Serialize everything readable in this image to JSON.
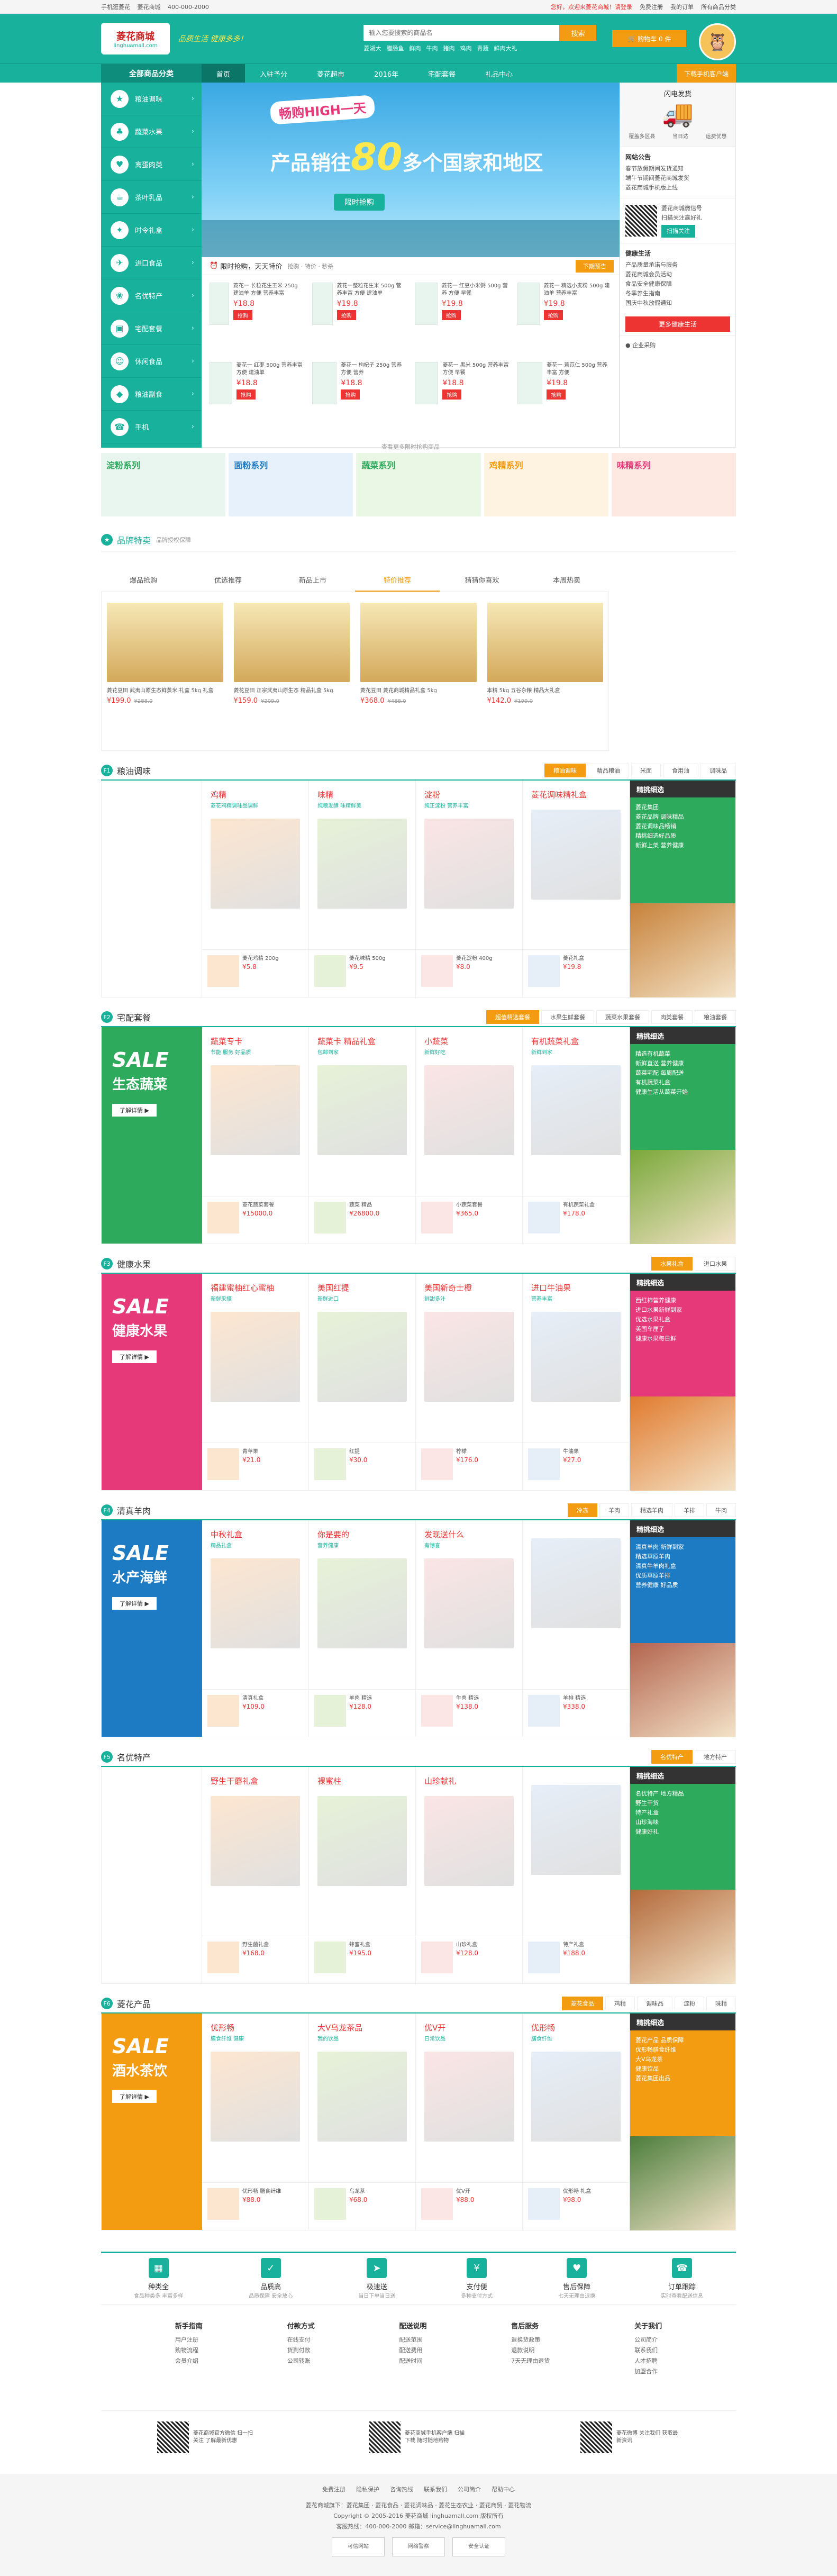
{
  "topbar": {
    "left": [
      "手机逛菱花",
      "菱花商城",
      "400-000-2000"
    ],
    "right": [
      "您好，欢迎来菱花商城！请登录",
      "免费注册",
      "我的订单",
      "所有商品分类"
    ]
  },
  "header": {
    "logo": "菱花商城",
    "logo_sub": "linghuamall.com",
    "slogan": "品质生活 健康多多！",
    "search_placeholder": "输入您要搜索的商品名",
    "search_button": "搜索",
    "hot": [
      "菱湖大",
      "腊肠鱼",
      "鲜肉",
      "牛肉",
      "猪肉",
      "鸡肉",
      "青蔬",
      "鲜肉大礼"
    ],
    "cart": "购物车 0 件"
  },
  "nav": {
    "allcat": "全部商品分类",
    "items": [
      "首页",
      "入驻予分",
      "菱花超市",
      "2016年",
      "宅配套餐",
      "礼品中心"
    ],
    "download": "下载手机客户端"
  },
  "cats": [
    {
      "label": "粮油调味",
      "icon": "★"
    },
    {
      "label": "蔬菜水果",
      "icon": "♣"
    },
    {
      "label": "禽蛋肉类",
      "icon": "♥"
    },
    {
      "label": "茶叶乳品",
      "icon": "☕"
    },
    {
      "label": "时令礼盒",
      "icon": "✦"
    },
    {
      "label": "进口食品",
      "icon": "✈"
    },
    {
      "label": "名优特产",
      "icon": "❀"
    },
    {
      "label": "宅配套餐",
      "icon": "▣"
    },
    {
      "label": "休闲食品",
      "icon": "☺"
    },
    {
      "label": "粮油副食",
      "icon": "◆"
    },
    {
      "label": "手机",
      "icon": "☎"
    }
  ],
  "banner": {
    "tag": "畅购HIGH一天",
    "line1": "产品销往",
    "num": "80",
    "line2": "多个国家和地区",
    "go": "限时抢购"
  },
  "flash": {
    "title": "限时抢购，天天特价",
    "sub": "抢购 · 特价 · 秒杀",
    "more": "下期预告",
    "buy": "抢购",
    "items": [
      {
        "t": "菱花一 长粒花生王米 250g 建油单 方便 营养丰富",
        "p": "¥18.8"
      },
      {
        "t": "菱花一整粒花生米 500g 营养丰富 方便 建油单",
        "p": "¥19.8"
      },
      {
        "t": "菱花一 红豆小米粥 500g 营养 方便 早餐",
        "p": "¥19.8"
      },
      {
        "t": "菱花一 精选小麦粉 500g 建油单 营养丰富",
        "p": "¥19.8"
      },
      {
        "t": "菱花一 红枣 500g 营养丰富 方便 建油单",
        "p": "¥18.8"
      },
      {
        "t": "菱花一 枸杞子 250g 营养 方便 营养",
        "p": "¥18.8"
      },
      {
        "t": "菱花一 黑米 500g 营养丰富 方便 早餐",
        "p": "¥18.8"
      },
      {
        "t": "菱花一 薏苡仁 500g 营养丰富 方便",
        "p": "¥19.8"
      }
    ],
    "more2": "查看更多限时抢购商品"
  },
  "side": {
    "delivery": "闪电发货",
    "d_items": [
      "覆盖多区县",
      "当日达",
      "运费优惠"
    ],
    "notice": "网站公告",
    "notices": [
      "春节放假期间发货通知",
      "端午节期间菱花商城发货",
      "菱花商城手机版上线"
    ],
    "qr_title": "菱花商城微信号",
    "qr_sub": "扫描关注赢好礼",
    "qr_btn": "扫描关注",
    "news": "健康生活",
    "news_items": [
      "产品质量承诺与服务",
      "菱花商城会员活动",
      "食品安全健康保障",
      "冬季养生指南",
      "国庆中秋放假通知"
    ],
    "redbtn": "更多健康生活",
    "corp": "企业采购"
  },
  "promo": [
    "淀粉系列",
    "面粉系列",
    "蔬菜系列",
    "鸡精系列",
    "味精系列"
  ],
  "brand": {
    "title": "品牌特卖",
    "sub": "品牌授权保障",
    "tabs": [
      "爆品抢购",
      "优选推荐",
      "新品上市",
      "特价推荐",
      "猜猜你喜欢",
      "本周热卖"
    ],
    "items": [
      {
        "t": "菱花豆田 武夷山原生态鲜蒸米 礼盒 5kg 礼盒",
        "p": "¥199.0",
        "o": "¥288.0"
      },
      {
        "t": "菱花豆田 正宗武夷山原生态 精品礼盒 5kg",
        "p": "¥159.0",
        "o": "¥209.0"
      },
      {
        "t": "菱花豆田 菱花商城精品礼盒 5kg",
        "p": "¥368.0",
        "o": "¥488.0"
      },
      {
        "t": "本精 5kg 五谷杂粮 精品大礼盒",
        "p": "¥142.0",
        "o": "¥199.0"
      }
    ]
  },
  "floors": [
    {
      "num": "F1",
      "name": "粮油调味",
      "tabs": [
        "粮油调味",
        "精品粮油",
        "米面",
        "食用油",
        "调味品"
      ],
      "color": "#fff",
      "sale": "",
      "sub": "",
      "big": [
        {
          "t": "鸡精",
          "s": "菱花鸡精调味品调鲜"
        },
        {
          "t": "味精",
          "s": "纯粮发酵 味精鲜美"
        },
        {
          "t": "淀粉",
          "s": "纯正淀粉 营养丰富"
        },
        {
          "t": "菱花调味精礼盒",
          "s": ""
        }
      ],
      "sm": [
        {
          "t": "菱花鸡精 200g",
          "p": "¥5.8"
        },
        {
          "t": "菱花味精 500g",
          "p": "¥9.5"
        },
        {
          "t": "菱花淀粉 400g",
          "p": "¥8.0"
        },
        {
          "t": "菱花礼盒",
          "p": "¥19.8"
        }
      ],
      "right": [
        "菱花集团",
        "菱花品牌 调味精品",
        "菱花调味品畅销",
        "精挑细选好品质",
        "新鲜上架 营养健康"
      ],
      "rc": "#2eaa5c",
      "pc": "#c7823a"
    },
    {
      "num": "F2",
      "name": "宅配套餐",
      "tabs": [
        "超值精选套餐",
        "水果生鲜套餐",
        "蔬菜水果套餐",
        "肉类套餐",
        "粮油套餐"
      ],
      "color": "#2eaa5c",
      "sale": "SALE",
      "sub": "生态蔬菜",
      "big": [
        {
          "t": "蔬菜专卡",
          "s": "节能 服务 好品质"
        },
        {
          "t": "蔬菜卡 精品礼盒",
          "s": "包邮到家"
        },
        {
          "t": "小蔬菜",
          "s": "新鲜好吃"
        },
        {
          "t": "有机蔬菜礼盒",
          "s": "新鲜到家"
        }
      ],
      "sm": [
        {
          "t": "菱花蔬菜套餐",
          "p": "¥15000.0"
        },
        {
          "t": "蔬菜 精品",
          "p": "¥26800.0"
        },
        {
          "t": "小蔬菜套餐",
          "p": "¥365.0"
        },
        {
          "t": "有机蔬菜礼盒",
          "p": "¥178.0"
        }
      ],
      "right": [
        "精选有机蔬菜",
        "新鲜直送 营养健康",
        "蔬菜宅配 每周配送",
        "有机蔬菜礼盒",
        "健康生活从蔬菜开始"
      ],
      "rc": "#2eaa5c",
      "pc": "#7aa83a"
    },
    {
      "num": "F3",
      "name": "健康水果",
      "tabs": [
        "水果礼盒",
        "进口水果"
      ],
      "color": "#e5397a",
      "sale": "SALE",
      "sub": "健康水果",
      "big": [
        {
          "t": "福建蜜柚红心蜜柚",
          "s": "新鲜采摘"
        },
        {
          "t": "美国红提",
          "s": "新鲜进口"
        },
        {
          "t": "美国新奇士橙",
          "s": "鲜甜多汁"
        },
        {
          "t": "进口牛油果",
          "s": "营养丰富"
        }
      ],
      "sm": [
        {
          "t": "青苹果",
          "p": "¥21.0"
        },
        {
          "t": "红提",
          "p": "¥30.0"
        },
        {
          "t": "柠檬",
          "p": "¥176.0"
        },
        {
          "t": "牛油果",
          "p": "¥27.0"
        }
      ],
      "right": [
        "西红柿营养健康",
        "进口水果新鲜到家",
        "优选水果礼盒",
        "美国车厘子",
        "健康水果每日鲜"
      ],
      "rc": "#e5397a",
      "pc": "#e07b2f"
    },
    {
      "num": "F4",
      "name": "清真羊肉",
      "tabs": [
        "冷冻",
        "羊肉",
        "精选羊肉",
        "羊排",
        "牛肉"
      ],
      "color": "#1d7bc4",
      "sale": "SALE",
      "sub": "水产海鲜",
      "big": [
        {
          "t": "中秋礼盒",
          "s": "精品礼盒"
        },
        {
          "t": "你是要的",
          "s": "营养健康"
        },
        {
          "t": "发现送什么",
          "s": "有惊喜"
        },
        {
          "t": "",
          "s": ""
        }
      ],
      "sm": [
        {
          "t": "清真礼盒",
          "p": "¥109.0"
        },
        {
          "t": "羊肉 精选",
          "p": "¥128.0"
        },
        {
          "t": "牛肉 精选",
          "p": "¥138.0"
        },
        {
          "t": "羊排 精选",
          "p": "¥338.0"
        }
      ],
      "right": [
        "清真羊肉 新鲜到家",
        "精选草原羊肉",
        "清真牛羊肉礼盒",
        "优质草原羊排",
        "营养健康 好品质"
      ],
      "rc": "#1d7bc4",
      "pc": "#b3654f"
    },
    {
      "num": "F5",
      "name": "名优特产",
      "tabs": [
        "名优特产",
        "地方特产"
      ],
      "color": "#fff",
      "sale": "",
      "sub": "",
      "big": [
        {
          "t": "野生干蘑礼盒",
          "s": ""
        },
        {
          "t": "裸蜜柱",
          "s": ""
        },
        {
          "t": "山珍献礼",
          "s": ""
        },
        {
          "t": "",
          "s": ""
        }
      ],
      "sm": [
        {
          "t": "野生菌礼盒",
          "p": "¥168.0"
        },
        {
          "t": "蜂蜜礼盒",
          "p": "¥195.0"
        },
        {
          "t": "山珍礼盒",
          "p": "¥128.0"
        },
        {
          "t": "特产礼盒",
          "p": "¥188.0"
        }
      ],
      "right": [
        "名优特产 地方精品",
        "野生干货",
        "特产礼盒",
        "山珍海味",
        "健康好礼"
      ],
      "rc": "#2eaa5c",
      "pc": "#b36a3b"
    },
    {
      "num": "F6",
      "name": "菱花产品",
      "tabs": [
        "菱花食品",
        "鸡精",
        "调味品",
        "淀粉",
        "味精"
      ],
      "color": "#f39c12",
      "sale": "SALE",
      "sub": "酒水茶饮",
      "big": [
        {
          "t": "优形畅",
          "s": "膳食纤维 健康"
        },
        {
          "t": "大V乌龙茶品",
          "s": "我的饮品"
        },
        {
          "t": "优V开",
          "s": "日常饮品"
        },
        {
          "t": "优形畅",
          "s": "膳食纤维"
        }
      ],
      "sm": [
        {
          "t": "优形畅 膳食纤维",
          "p": "¥88.0"
        },
        {
          "t": "乌龙茶",
          "p": "¥68.0"
        },
        {
          "t": "优V开",
          "p": "¥88.0"
        },
        {
          "t": "优形畅 礼盒",
          "p": "¥98.0"
        }
      ],
      "right": [
        "菱花产品 品质保障",
        "优形畅膳食纤维",
        "大V乌龙茶",
        "健康饮品",
        "菱花集团出品"
      ],
      "rc": "#f39c12",
      "pc": "#4c7d3c"
    }
  ],
  "services": [
    {
      "t": "种类全",
      "d": "食品种类多 丰富多样",
      "i": "▦"
    },
    {
      "t": "品质高",
      "d": "品质保障 安全放心",
      "i": "✓"
    },
    {
      "t": "极速送",
      "d": "当日下单当日送",
      "i": "➤"
    },
    {
      "t": "支付便",
      "d": "多种支付方式",
      "i": "¥"
    },
    {
      "t": "售后保障",
      "d": "七天无理由退换",
      "i": "♥"
    },
    {
      "t": "订单跟踪",
      "d": "实时查看配送信息",
      "i": "☎"
    }
  ],
  "links": [
    {
      "h": "新手指南",
      "i": [
        "用户注册",
        "购物流程",
        "会员介绍"
      ]
    },
    {
      "h": "付款方式",
      "i": [
        "在线支付",
        "货到付款",
        "公司转账"
      ]
    },
    {
      "h": "配送说明",
      "i": [
        "配送范围",
        "配送费用",
        "配送时间"
      ]
    },
    {
      "h": "售后服务",
      "i": [
        "退换货政策",
        "退款说明",
        "7天无理由退货"
      ]
    },
    {
      "h": "关于我们",
      "i": [
        "公司简介",
        "联系我们",
        "人才招聘",
        "加盟合作"
      ]
    }
  ],
  "qrs": [
    {
      "t": "菱花商城官方微信 扫一扫关注 了解最新优惠"
    },
    {
      "t": "菱花商城手机客户端 扫描下载 随时随地购物"
    },
    {
      "t": "菱花微博 关注我们 获取最新资讯"
    }
  ],
  "footer": {
    "links": [
      "免费注册",
      "隐私保护",
      "咨询热线",
      "联系我们",
      "公司简介",
      "帮助中心"
    ],
    "line1": "菱花商城旗下：菱花集团 · 菱花食品 · 菱花调味品 · 菱花生态农业 · 菱花商贸 · 菱花物流",
    "line2": "Copyright © 2005-2016 菱花商城 linghuamall.com 版权所有",
    "line3": "客服热线：400-000-2000  邮箱：service@linghuamall.com",
    "badges": [
      "可信网站",
      "网络警察",
      "安全认证"
    ]
  }
}
